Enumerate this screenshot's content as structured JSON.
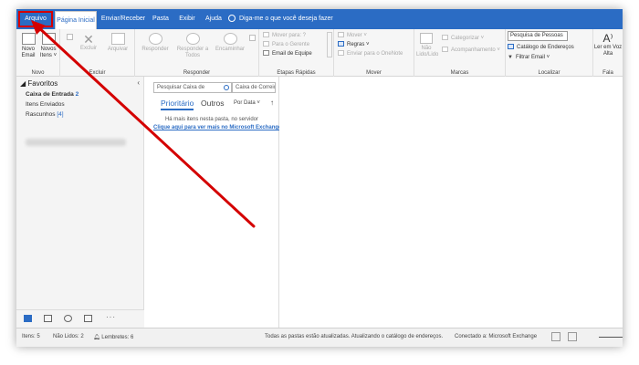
{
  "tabs": {
    "arquivo": "Arquivo",
    "pagina_inicial": "Página Inicial",
    "enviar_receber": "Enviar/Receber",
    "pasta": "Pasta",
    "exibir": "Exibir",
    "ajuda": "Ajuda",
    "tell_me": "Diga-me o que você deseja fazer"
  },
  "ribbon": {
    "novo": {
      "novo_email": "Novo Email",
      "novos_itens": "Novos Itens ˅",
      "label": "Novo"
    },
    "excluir": {
      "excluir": "Excluir",
      "arquivar": "Arquivar",
      "label": "Excluir"
    },
    "responder": {
      "responder": "Responder",
      "responder_todos": "Responder a Todos",
      "encaminhar": "Encaminhar",
      "label": "Responder"
    },
    "etapas": {
      "mover_para": "Mover para: ?",
      "para_gerente": "Para o Gerente",
      "email_equipe": "Email de Equipe",
      "label": "Etapas Rápidas"
    },
    "mover": {
      "mover": "Mover ˅",
      "regras": "Regras ˅",
      "onenote": "Enviar para o OneNote",
      "label": "Mover"
    },
    "marcas": {
      "nao_lido": "Não Lido/Lido",
      "categorizar": "Categorizar ˅",
      "acompanhamento": "Acompanhamento ˅",
      "label": "Marcas"
    },
    "localizar": {
      "pesquisa_pessoas": "Pesquisa de Pessoas",
      "catalogo": "Catálogo de Endereços",
      "filtrar": "Filtrar Email ˅",
      "label": "Localizar"
    },
    "fala": {
      "ler_em_voz": "Ler em Voz Alta",
      "label": "Fala"
    }
  },
  "nav": {
    "favoritos": "Favoritos",
    "caixa_entrada": "Caixa de Entrada",
    "caixa_entrada_count": "2",
    "itens_enviados": "Itens Enviados",
    "rascunhos": "Rascunhos",
    "rascunhos_count": "[4]"
  },
  "list": {
    "search_placeholder": "Pesquisar Caixa de",
    "scope": "Caixa de Correio Atual",
    "prioritario": "Prioritário",
    "outros": "Outros",
    "sort": "Por Data ˅",
    "empty": "Há mais itens nesta pasta, no servidor",
    "exchange_link": "Clique aqui para ver mais no Microsoft Exchange"
  },
  "status": {
    "itens": "Itens: 5",
    "nao_lidos": "Não Lidos: 2",
    "lembretes": "Lembretes: 6",
    "sync": "Todas as pastas estão atualizadas. Atualizando o catálogo de endereços.",
    "connection": "Conectado a: Microsoft Exchange"
  },
  "colors": {
    "brand": "#2b6cc4",
    "highlight": "#d40000"
  }
}
